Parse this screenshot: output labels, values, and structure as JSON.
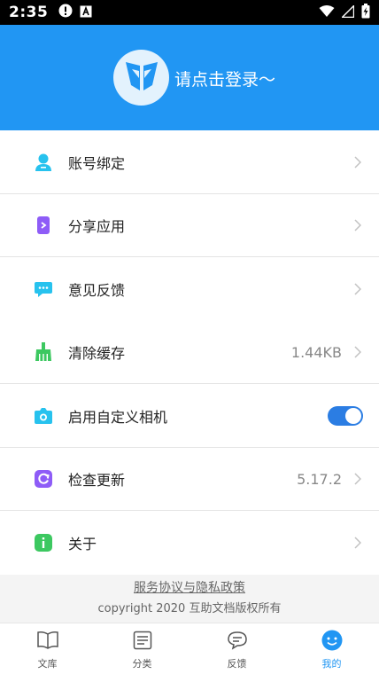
{
  "status": {
    "time": "2:35"
  },
  "header": {
    "login_prompt": "请点击登录～"
  },
  "menu": [
    {
      "name": "account-binding",
      "label": "账号绑定",
      "icon": "user-icon",
      "color": "#27c2ee"
    },
    {
      "name": "share-app",
      "label": "分享应用",
      "icon": "share-phone-icon",
      "color": "#8e5cf7"
    },
    {
      "name": "feedback",
      "label": "意见反馈",
      "icon": "chat-bubble-icon",
      "color": "#27c2ee"
    },
    {
      "name": "clear-cache",
      "label": "清除缓存",
      "value": "1.44KB",
      "icon": "broom-icon",
      "color": "#3cc860"
    },
    {
      "name": "custom-camera",
      "label": "启用自定义相机",
      "icon": "camera-icon",
      "color": "#27c2ee",
      "toggle_on": true
    },
    {
      "name": "check-update",
      "label": "检查更新",
      "value": "5.17.2",
      "icon": "refresh-icon",
      "color": "#8e5cf7"
    },
    {
      "name": "about",
      "label": "关于",
      "icon": "info-icon",
      "color": "#3cc860"
    }
  ],
  "footer": {
    "policy_link": "服务协议与隐私政策",
    "copyright": "copyright 2020 互助文档版权所有"
  },
  "tabs": [
    {
      "label": "文库",
      "icon": "book-icon",
      "active": false
    },
    {
      "label": "分类",
      "icon": "list-icon",
      "active": false
    },
    {
      "label": "反馈",
      "icon": "message-icon",
      "active": false
    },
    {
      "label": "我的",
      "icon": "smile-face-icon",
      "active": true
    }
  ],
  "colors": {
    "brand": "#2196f3",
    "toggle": "#2b7de3"
  }
}
